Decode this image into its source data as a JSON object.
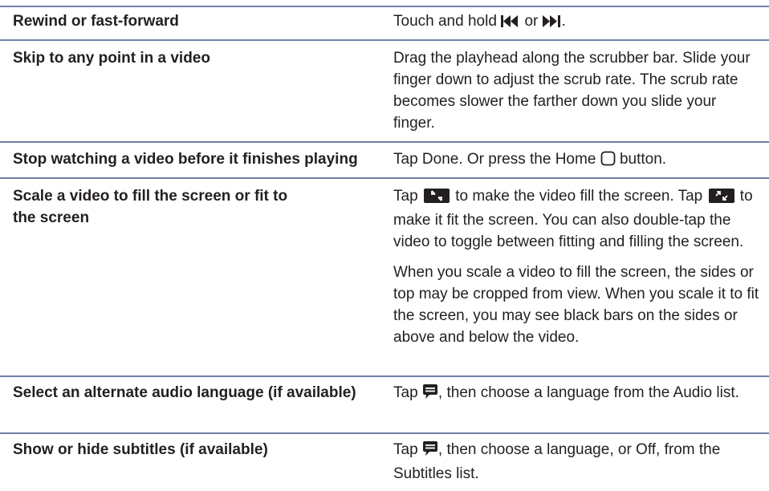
{
  "rows": [
    {
      "action": "Rewind or fast-forward",
      "desc": {
        "before": "Touch and hold ",
        "middle": " or ",
        "after": "."
      },
      "icons": [
        "rewind-icon",
        "fast-forward-icon"
      ]
    },
    {
      "action": "Skip to any point in a video",
      "desc": "Drag the playhead along the scrubber bar. Slide your finger down to adjust the scrub rate. The scrub rate becomes slower the farther down you slide your finger."
    },
    {
      "action": "Stop watching a video before it finishes playing",
      "desc": {
        "before": "Tap Done. Or press the Home ",
        "after": " button."
      },
      "icons": [
        "home-button-icon"
      ]
    },
    {
      "action": "Scale a video to fill the screen or fit to the screen",
      "desc": {
        "p1_before": "Tap ",
        "p1_middle": " to make the video fill the screen. Tap ",
        "p1_after": " to make it fit the screen. You can also double-tap the video to toggle between fitting and filling the screen.",
        "p2": "When you scale a video to fill the screen, the sides or top may be cropped from view. When you scale it to fit the screen, you may see black bars on the sides or above and below the video."
      },
      "icons": [
        "fill-screen-icon",
        "fit-screen-icon"
      ]
    },
    {
      "action": "Select an alternate audio language (if available)",
      "desc": {
        "before": "Tap ",
        "after": ", then choose a language from the Audio list."
      },
      "icons": [
        "speech-bubble-icon"
      ]
    },
    {
      "action": "Show or hide subtitles (if available)",
      "desc": {
        "before": "Tap ",
        "after": ", then choose a language, or Off, from the Subtitles list."
      },
      "icons": [
        "speech-bubble-icon"
      ]
    }
  ],
  "colors": {
    "rule": "#6f7fa8",
    "text": "#231f20"
  }
}
